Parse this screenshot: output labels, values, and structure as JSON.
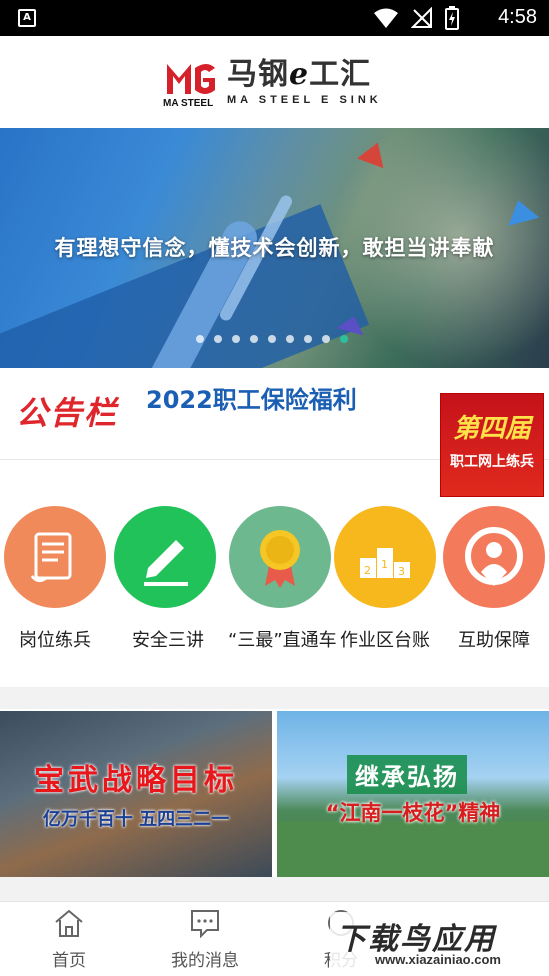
{
  "status_bar": {
    "time": "4:58",
    "left_icon": "A"
  },
  "header": {
    "logo_cn_prefix": "马钢",
    "logo_cn_e": "e",
    "logo_cn_suffix": "工汇",
    "logo_en": "MA STEEL E SINK",
    "logo_mark_text": "MA STEEL"
  },
  "banner": {
    "slogan": "有理想守信念，懂技术会创新，敢担当讲奉献",
    "slide_count": 9,
    "active_slide": 9
  },
  "notice": {
    "label": "公告栏",
    "title": "2022职工保险福利"
  },
  "promo": {
    "big_text": "第四届",
    "small_text": "职工网上练兵"
  },
  "grid": [
    {
      "label": "岗位练兵",
      "icon": "scroll-icon",
      "color": "#f08a5a"
    },
    {
      "label": "安全三讲",
      "icon": "pen-edit-icon",
      "color": "#21c25a"
    },
    {
      "label": "“三最”直通车",
      "icon": "medal-icon",
      "color": "#6db88e"
    },
    {
      "label": "作业区台账",
      "icon": "podium-icon",
      "color": "#f7b81e"
    },
    {
      "label": "互助保障",
      "icon": "shield-person-icon",
      "color": "#f47a5c"
    }
  ],
  "features": [
    {
      "title": "宝武战略目标",
      "subtitle": "亿万千百十  五四三二一"
    },
    {
      "title": "继承弘扬",
      "subtitle": "“江南一枝花”精神"
    }
  ],
  "bottom_nav": [
    {
      "label": "首页",
      "icon": "home-icon"
    },
    {
      "label": "我的消息",
      "icon": "message-icon"
    },
    {
      "label": "积分",
      "icon": "points-icon"
    }
  ],
  "watermark": {
    "cn": "下载鸟应用",
    "en": "www.xiazainiao.com"
  }
}
